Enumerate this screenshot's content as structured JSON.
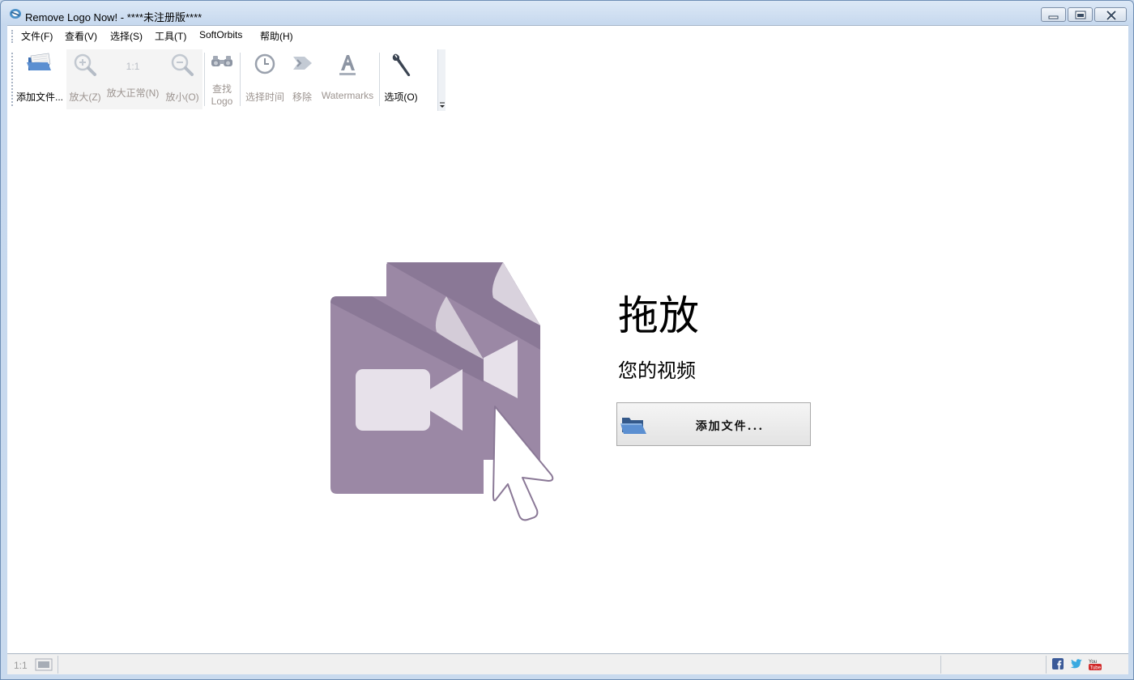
{
  "window": {
    "title": "Remove Logo Now! - ****未注册版****"
  },
  "menu": {
    "items": [
      {
        "label": "文件(F)"
      },
      {
        "label": "查看(V)"
      },
      {
        "label": "选择(S)"
      },
      {
        "label": "工具(T)"
      },
      {
        "label": "SoftOrbits"
      },
      {
        "label": "帮助(H)"
      }
    ]
  },
  "toolbar": {
    "add_file": "添加文件...",
    "zoom_in": "放大(Z)",
    "zoom_normal_icon_text": "1:1",
    "zoom_normal": "放大正常(N)",
    "zoom_out": "放小(O)",
    "find_logo_line1": "查找",
    "find_logo_line2": "Logo",
    "select_time": "选择时间",
    "remove": "移除",
    "watermarks": "Watermarks",
    "options": "选项(O)"
  },
  "main": {
    "drop_title": "拖放",
    "drop_subtitle": "您的视频",
    "add_file_button": "添加文件..."
  },
  "statusbar": {
    "zoom_label": "1:1"
  },
  "colors": {
    "art_purple": "#9b88a5",
    "art_purple_dark": "#8a7896",
    "art_light": "#e7e1ea",
    "folder_blue": "#5b8fd1"
  },
  "icons": [
    "app-icon",
    "minimize-icon",
    "restore-icon",
    "close-icon",
    "folder-icon",
    "zoom-in-icon",
    "zoom-out-icon",
    "binoculars-icon",
    "clock-icon",
    "remove-arrow-icon",
    "watermark-icon",
    "wrench-icon",
    "fit-screen-icon",
    "facebook-icon",
    "twitter-icon",
    "youtube-icon"
  ]
}
